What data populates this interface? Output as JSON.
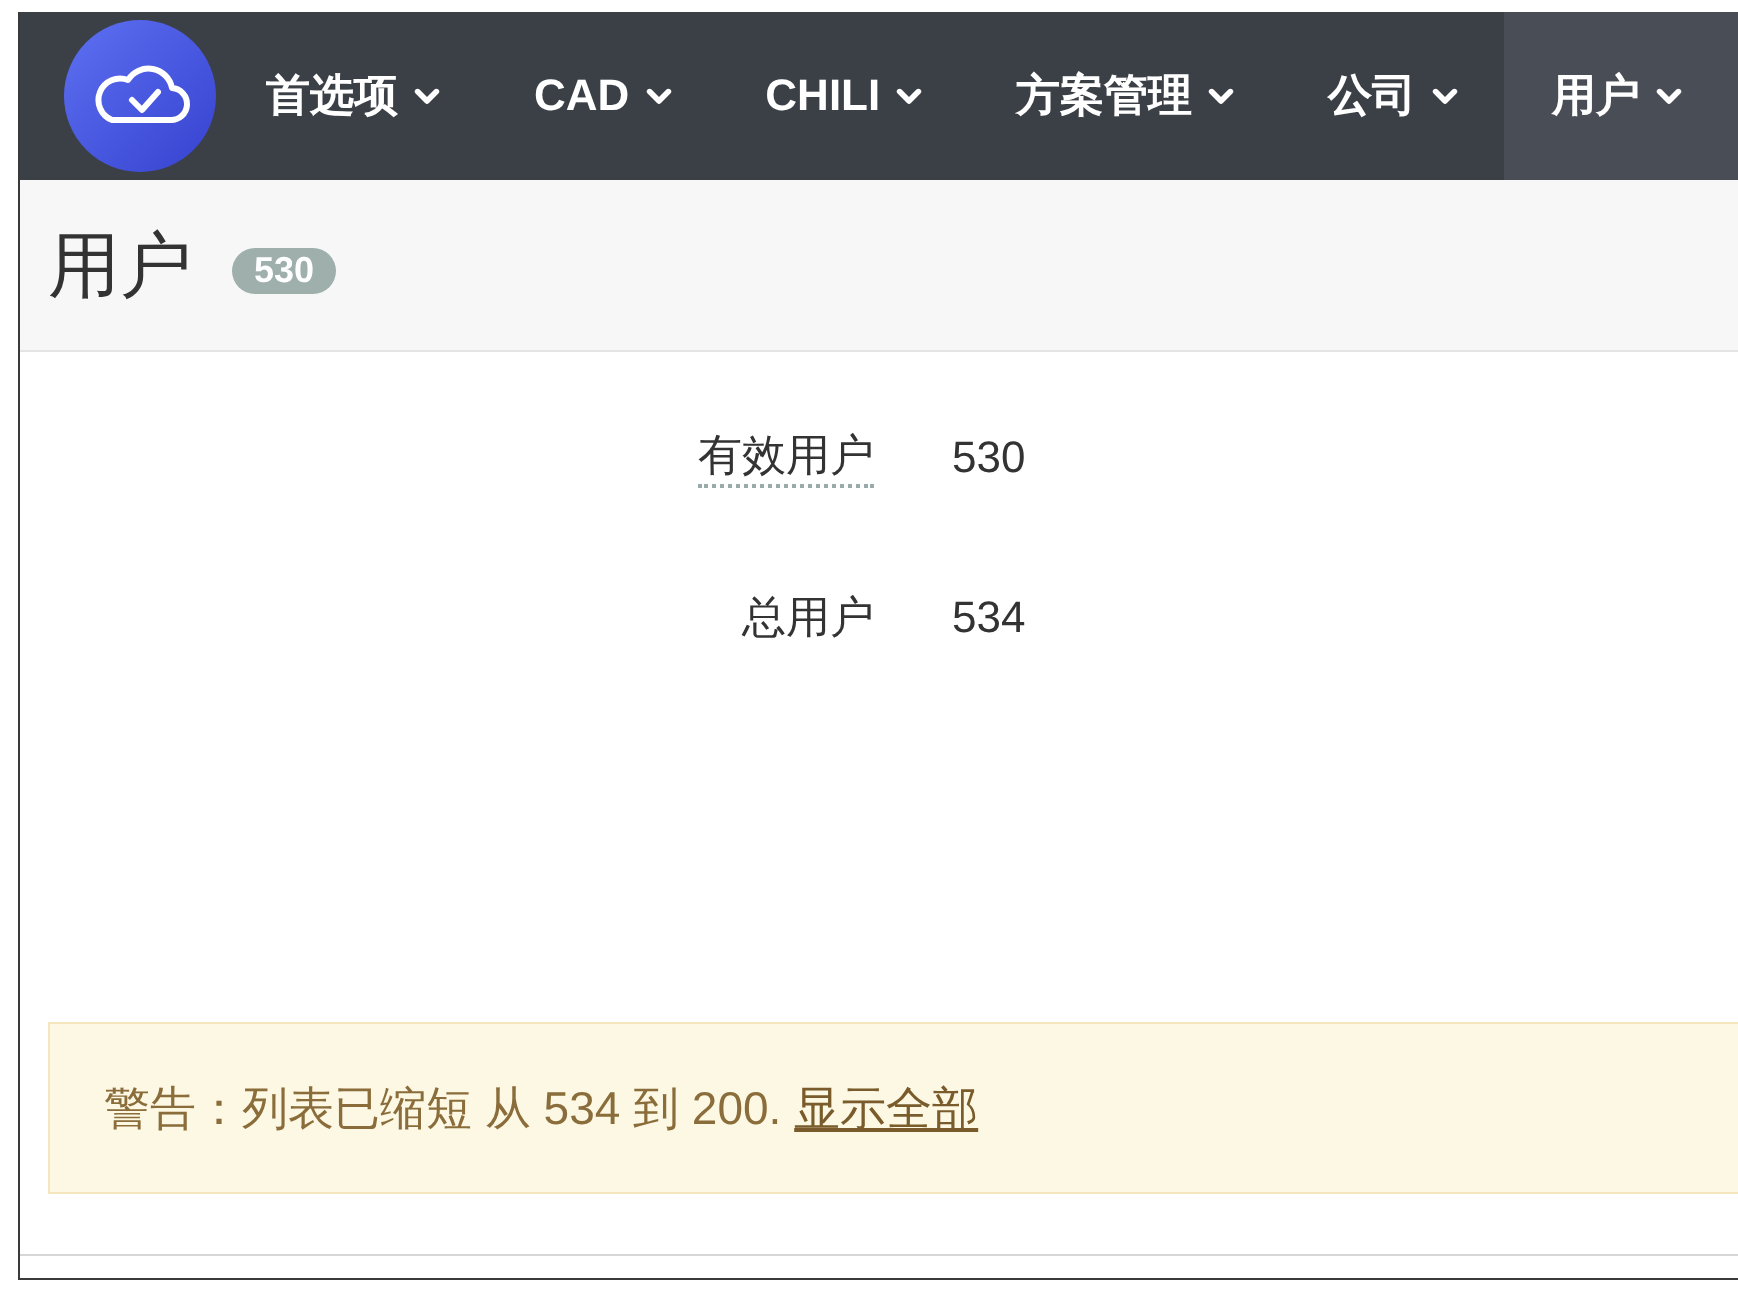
{
  "nav": {
    "items": [
      {
        "label": "首选项",
        "selected": false
      },
      {
        "label": "CAD",
        "selected": false
      },
      {
        "label": "CHILI",
        "selected": false
      },
      {
        "label": "方案管理",
        "selected": false
      },
      {
        "label": "公司",
        "selected": false
      },
      {
        "label": "用户",
        "selected": true
      }
    ]
  },
  "header": {
    "title": "用户",
    "badge": "530"
  },
  "stats": [
    {
      "kind": "hint",
      "label": "有效用户",
      "value": "530"
    },
    {
      "kind": "plain",
      "label": "总用户",
      "value": "534"
    }
  ],
  "alert": {
    "text": "警告：列表已缩短 从 534 到 200.",
    "link": "显示全部"
  }
}
